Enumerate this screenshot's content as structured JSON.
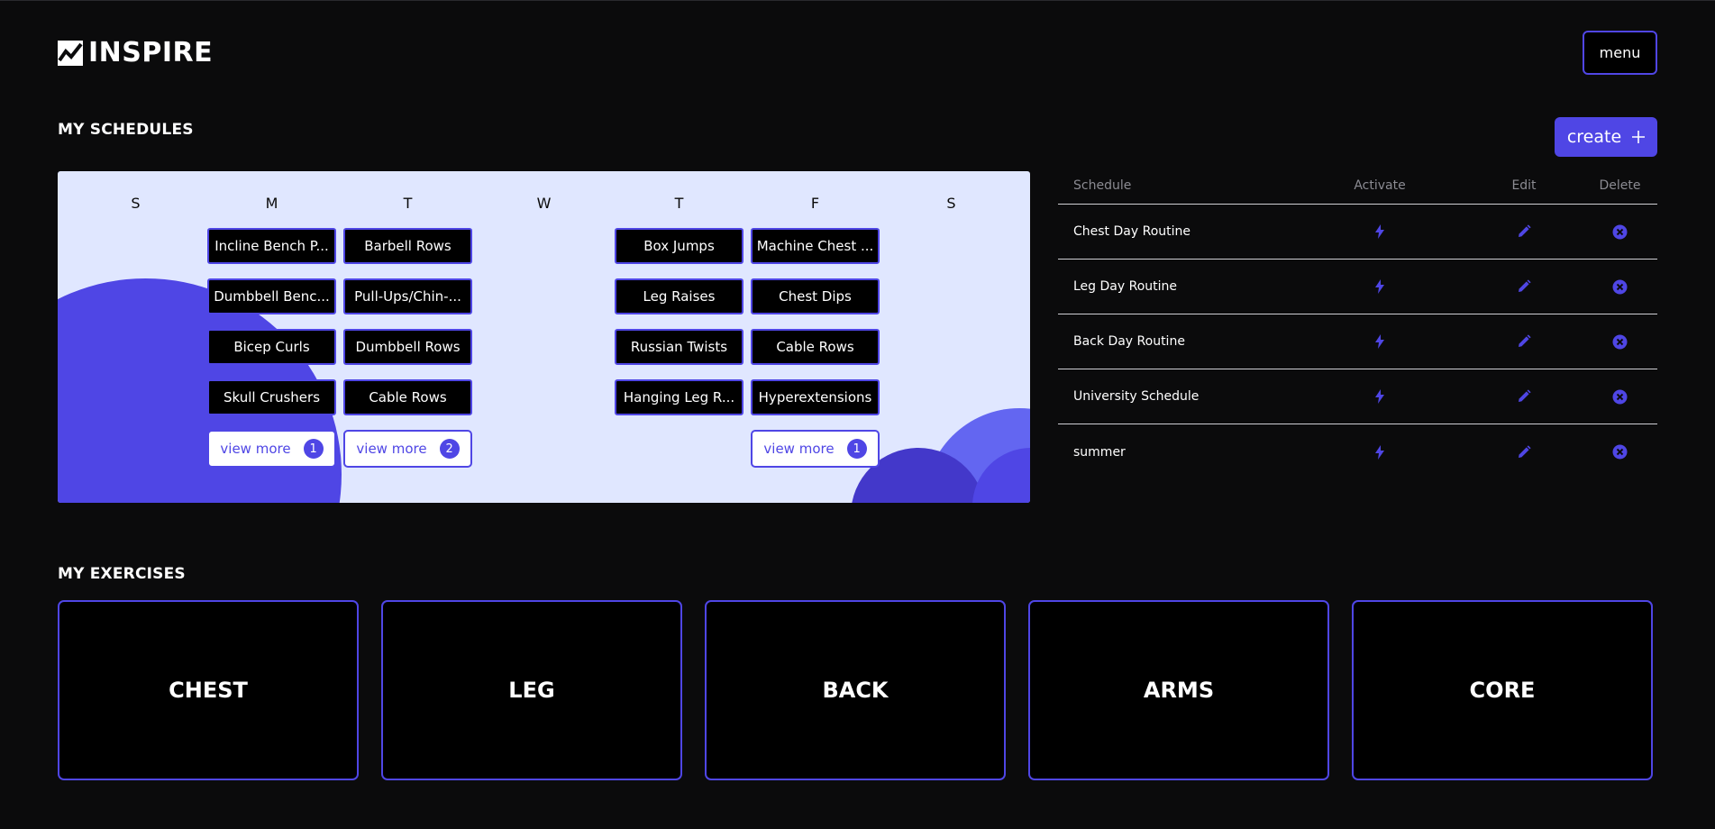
{
  "app": {
    "logo_text": "INSPIRE"
  },
  "header": {
    "menu_label": "menu"
  },
  "schedules": {
    "title": "MY SCHEDULES",
    "create_label": "create",
    "create_icon": "plus-icon",
    "days": [
      "S",
      "M",
      "T",
      "W",
      "T",
      "F",
      "S"
    ],
    "columns": [
      {
        "items": [],
        "view_more": null
      },
      {
        "items": [
          "Incline Bench P...",
          "Dumbbell Benc...",
          "Bicep Curls",
          "Skull Crushers"
        ],
        "view_more": {
          "label": "view more",
          "count": "1"
        }
      },
      {
        "items": [
          "Barbell Rows",
          "Pull-Ups/Chin-...",
          "Dumbbell Rows",
          "Cable Rows"
        ],
        "view_more": {
          "label": "view more",
          "count": "2"
        }
      },
      {
        "items": [],
        "view_more": null
      },
      {
        "items": [
          "Box Jumps",
          "Leg Raises",
          "Russian Twists",
          "Hanging Leg R..."
        ],
        "view_more": null
      },
      {
        "items": [
          "Machine Chest ...",
          "Chest Dips",
          "Cable Rows",
          "Hyperextensions"
        ],
        "view_more": {
          "label": "view more",
          "count": "1"
        }
      },
      {
        "items": [],
        "view_more": null
      }
    ]
  },
  "schedule_table": {
    "headers": {
      "schedule": "Schedule",
      "activate": "Activate",
      "edit": "Edit",
      "delete": "Delete"
    },
    "rows": [
      {
        "name": "Chest Day Routine"
      },
      {
        "name": "Leg Day Routine"
      },
      {
        "name": "Back Day Routine"
      },
      {
        "name": "University Schedule"
      },
      {
        "name": "summer"
      }
    ],
    "accent": "#4f46e5"
  },
  "exercises": {
    "title": "MY EXERCISES",
    "categories": [
      "CHEST",
      "LEG",
      "BACK",
      "ARMS",
      "CORE"
    ]
  }
}
